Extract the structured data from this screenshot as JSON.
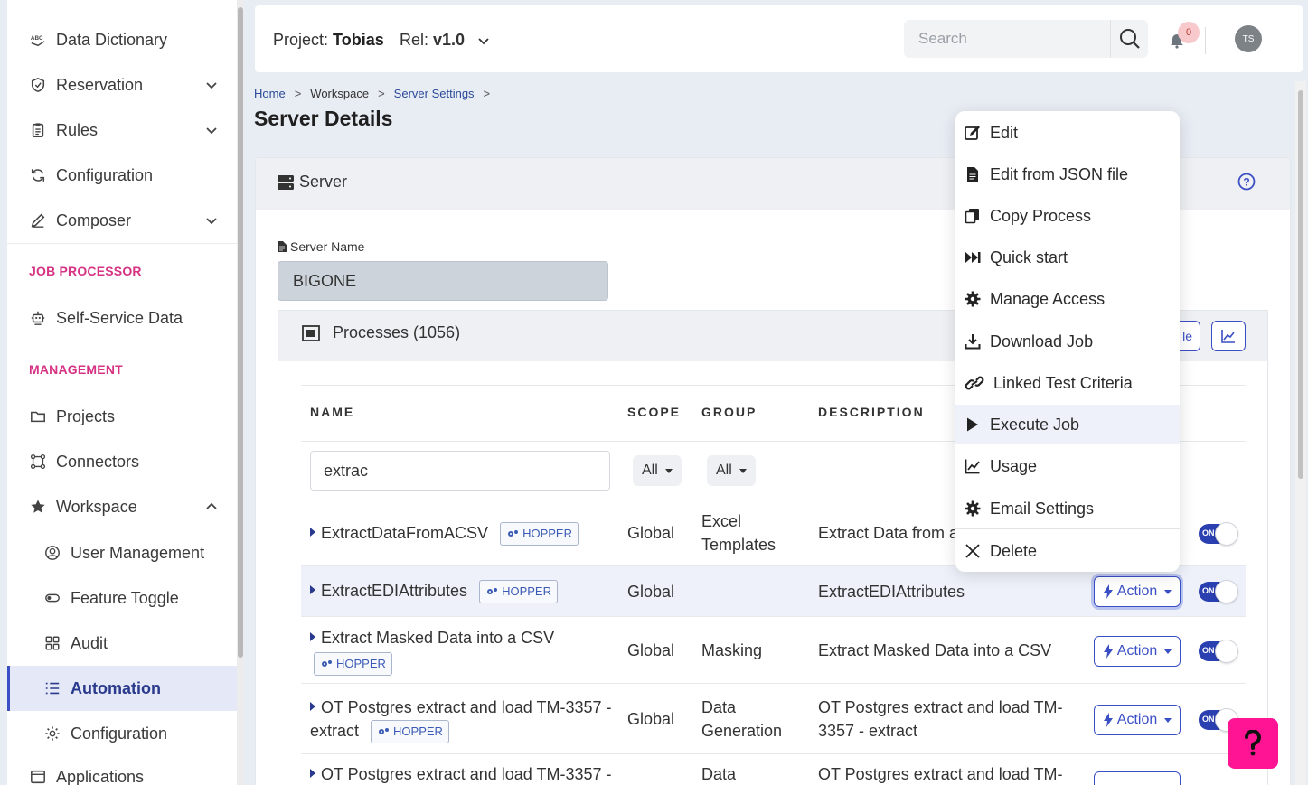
{
  "sidebar": {
    "items": [
      {
        "label": "Data Dictionary",
        "icon": "abc-icon"
      },
      {
        "label": "Reservation",
        "icon": "shield-icon"
      },
      {
        "label": "Rules",
        "icon": "clipboard-icon"
      },
      {
        "label": "Configuration",
        "icon": "sync-icon"
      },
      {
        "label": "Composer",
        "icon": "pen-icon"
      }
    ],
    "section_job": "JOB PROCESSOR",
    "self_service": "Self-Service Data",
    "section_management": "MANAGEMENT",
    "management_items": [
      {
        "label": "Projects",
        "icon": "folder-icon"
      },
      {
        "label": "Connectors",
        "icon": "connectors-icon"
      },
      {
        "label": "Workspace",
        "icon": "star-icon"
      }
    ],
    "workspace_sub": [
      {
        "label": "User Management",
        "icon": "user-circle-icon"
      },
      {
        "label": "Feature Toggle",
        "icon": "toggle-icon"
      },
      {
        "label": "Audit",
        "icon": "grid-icon"
      },
      {
        "label": "Automation",
        "icon": "list-icon"
      },
      {
        "label": "Configuration",
        "icon": "gear-icon"
      },
      {
        "label": "Applications",
        "icon": "apps-icon"
      }
    ]
  },
  "topbar": {
    "project_label": "Project:",
    "project_name": "Tobias",
    "rel_label": "Rel:",
    "rel_value": "v1.0",
    "search_placeholder": "Search",
    "notifications": "0",
    "avatar": "TS"
  },
  "breadcrumb": [
    "Home",
    "Workspace",
    "Server Settings"
  ],
  "page_title": "Server Details",
  "server": {
    "header": "Server",
    "field_label": "Server Name",
    "name": "BIGONE"
  },
  "processes": {
    "header": "Processes (1056)",
    "header_btn_partial": "le",
    "columns": [
      "NAME",
      "SCOPE",
      "GROUP",
      "DESCRIPTION"
    ],
    "filter_value": "extrac",
    "scope_filter": "All",
    "group_filter": "All",
    "tag": "HOPPER",
    "action_label": "Action",
    "toggle_label": "ON",
    "rows": [
      {
        "name": "ExtractDataFromACSV",
        "scope": "Global",
        "group_line1": "Excel",
        "group_line2": "Templates",
        "desc_line1": "Extract Data from a",
        "desc_line2": ""
      },
      {
        "name": "ExtractEDIAttributes",
        "scope": "Global",
        "group_line1": "",
        "group_line2": "",
        "desc_line1": "ExtractEDIAttributes",
        "desc_line2": ""
      },
      {
        "name": "Extract Masked Data into a CSV",
        "scope": "Global",
        "group_line1": "Masking",
        "group_line2": "",
        "desc_line1": "Extract Masked Data into a CSV",
        "desc_line2": ""
      },
      {
        "name": "OT Postgres extract and load TM-3357 -",
        "name_line2": "extract",
        "scope": "Global",
        "group_line1": "Data",
        "group_line2": "Generation",
        "desc_line1": "OT Postgres extract and load TM-",
        "desc_line2": "3357 - extract"
      },
      {
        "name": "OT Postgres extract and load TM-3357 -",
        "scope": "",
        "group_line1": "Data",
        "group_line2": "",
        "desc_line1": "OT Postgres extract and load TM-",
        "desc_line2": ""
      }
    ]
  },
  "context_menu": [
    {
      "label": "Edit",
      "icon": "edit-icon"
    },
    {
      "label": "Edit from JSON file",
      "icon": "file-icon"
    },
    {
      "label": "Copy Process",
      "icon": "copy-icon"
    },
    {
      "label": "Quick start",
      "icon": "fast-forward-icon"
    },
    {
      "label": "Manage Access",
      "icon": "gear-icon"
    },
    {
      "label": "Download Job",
      "icon": "download-icon"
    },
    {
      "label": "Linked Test Criteria",
      "icon": "link-icon"
    },
    {
      "label": "Execute Job",
      "icon": "play-icon"
    },
    {
      "label": "Usage",
      "icon": "chart-line-icon"
    },
    {
      "label": "Email Settings",
      "icon": "gear-icon"
    },
    {
      "label": "Delete",
      "icon": "close-icon"
    }
  ],
  "colors": {
    "accent": "#3b4fc4",
    "section": "#d63384",
    "fab": "#ff1493"
  }
}
